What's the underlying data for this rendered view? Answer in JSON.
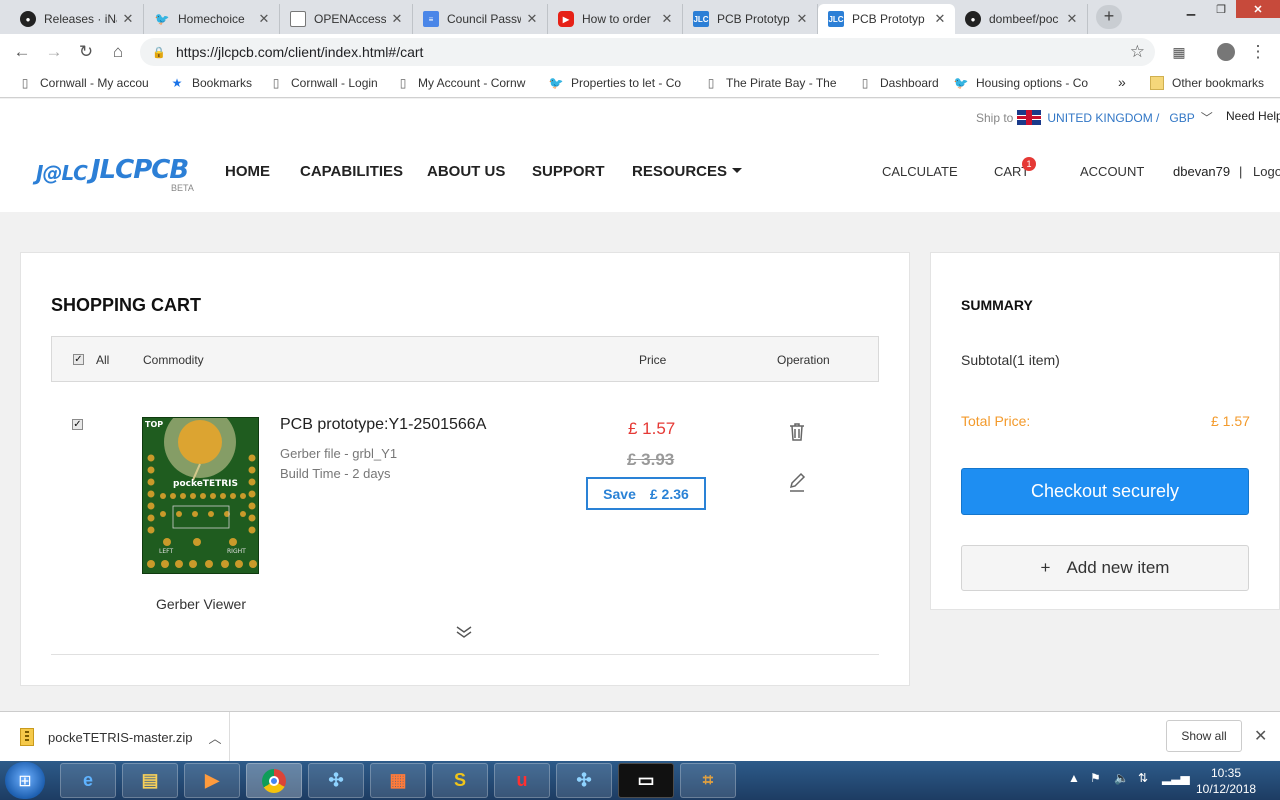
{
  "browser": {
    "tabs": [
      {
        "title": "Releases · iNa",
        "icon": "github-icon"
      },
      {
        "title": "Homechoice",
        "icon": "bird-icon"
      },
      {
        "title": "OPENAccess",
        "icon": "page-icon"
      },
      {
        "title": "Council Passw",
        "icon": "docs-icon"
      },
      {
        "title": "How to order",
        "icon": "youtube-icon"
      },
      {
        "title": "PCB Prototyp",
        "icon": "jlc-icon"
      },
      {
        "title": "PCB Prototyp",
        "icon": "jlc-icon",
        "active": true
      },
      {
        "title": "dombeef/poc",
        "icon": "github-icon"
      }
    ],
    "url": "https://jlcpcb.com/client/index.html#/cart",
    "bookmarks": [
      {
        "label": "Cornwall - My accou",
        "icon": "page-icon"
      },
      {
        "label": "Bookmarks",
        "icon": "star-icon"
      },
      {
        "label": "Cornwall - Login",
        "icon": "page-icon"
      },
      {
        "label": "My Account - Cornw",
        "icon": "page-icon"
      },
      {
        "label": "Properties to let - Co",
        "icon": "bird-icon"
      },
      {
        "label": "The Pirate Bay - The",
        "icon": "page-icon"
      },
      {
        "label": "Dashboard",
        "icon": "page-icon"
      },
      {
        "label": "Housing options - Co",
        "icon": "bird-icon"
      }
    ],
    "more_bookmarks": "»",
    "other_bookmarks": "Other bookmarks"
  },
  "site": {
    "ship_to_label": "Ship to",
    "country": "UNITED KINGDOM /",
    "currency": "GBP",
    "need_help": "Need Help",
    "logo_mark": "J@LC",
    "logo_word": "JLCPCB",
    "logo_beta": "BETA",
    "nav": [
      "HOME",
      "CAPABILITIES",
      "ABOUT US",
      "SUPPORT",
      "RESOURCES"
    ],
    "calculate": "CALCULATE",
    "cart": "CART",
    "cart_count": "1",
    "account": "ACCOUNT",
    "username": "dbevan79",
    "separator": "|",
    "logout": "Logout"
  },
  "cart": {
    "title": "SHOPPING CART",
    "col_all": "All",
    "col_commodity": "Commodity",
    "col_price": "Price",
    "col_operation": "Operation",
    "item": {
      "name": "PCB prototype:Y1-2501566A",
      "gerber_file": "Gerber file - grbl_Y1",
      "build_time": "Build Time - 2 days",
      "price": "£ 1.57",
      "old_price": "£ 3.93",
      "save_label": "Save",
      "save_amount": "£ 2.36",
      "gerber_viewer": "Gerber Viewer",
      "pcb_top": "TOP",
      "pcb_name": "pockeTETRIS",
      "pcb_left": "LEFT",
      "pcb_right": "RIGHT"
    }
  },
  "summary": {
    "title": "SUMMARY",
    "subtotal": "Subtotal(1 item)",
    "total_label": "Total Price:",
    "total_value": "£ 1.57",
    "checkout": "Checkout securely",
    "add_new_plus": "+",
    "add_new": "Add new item"
  },
  "downloads": {
    "file": "pockeTETRIS-master.zip",
    "show_all": "Show all"
  },
  "taskbar": {
    "time": "10:35",
    "date": "10/12/2018"
  },
  "colors": {
    "brand_blue": "#2c7fd6",
    "price_red": "#e53935",
    "total_orange": "#f39a2b",
    "checkout_blue": "#1e8ef2"
  }
}
